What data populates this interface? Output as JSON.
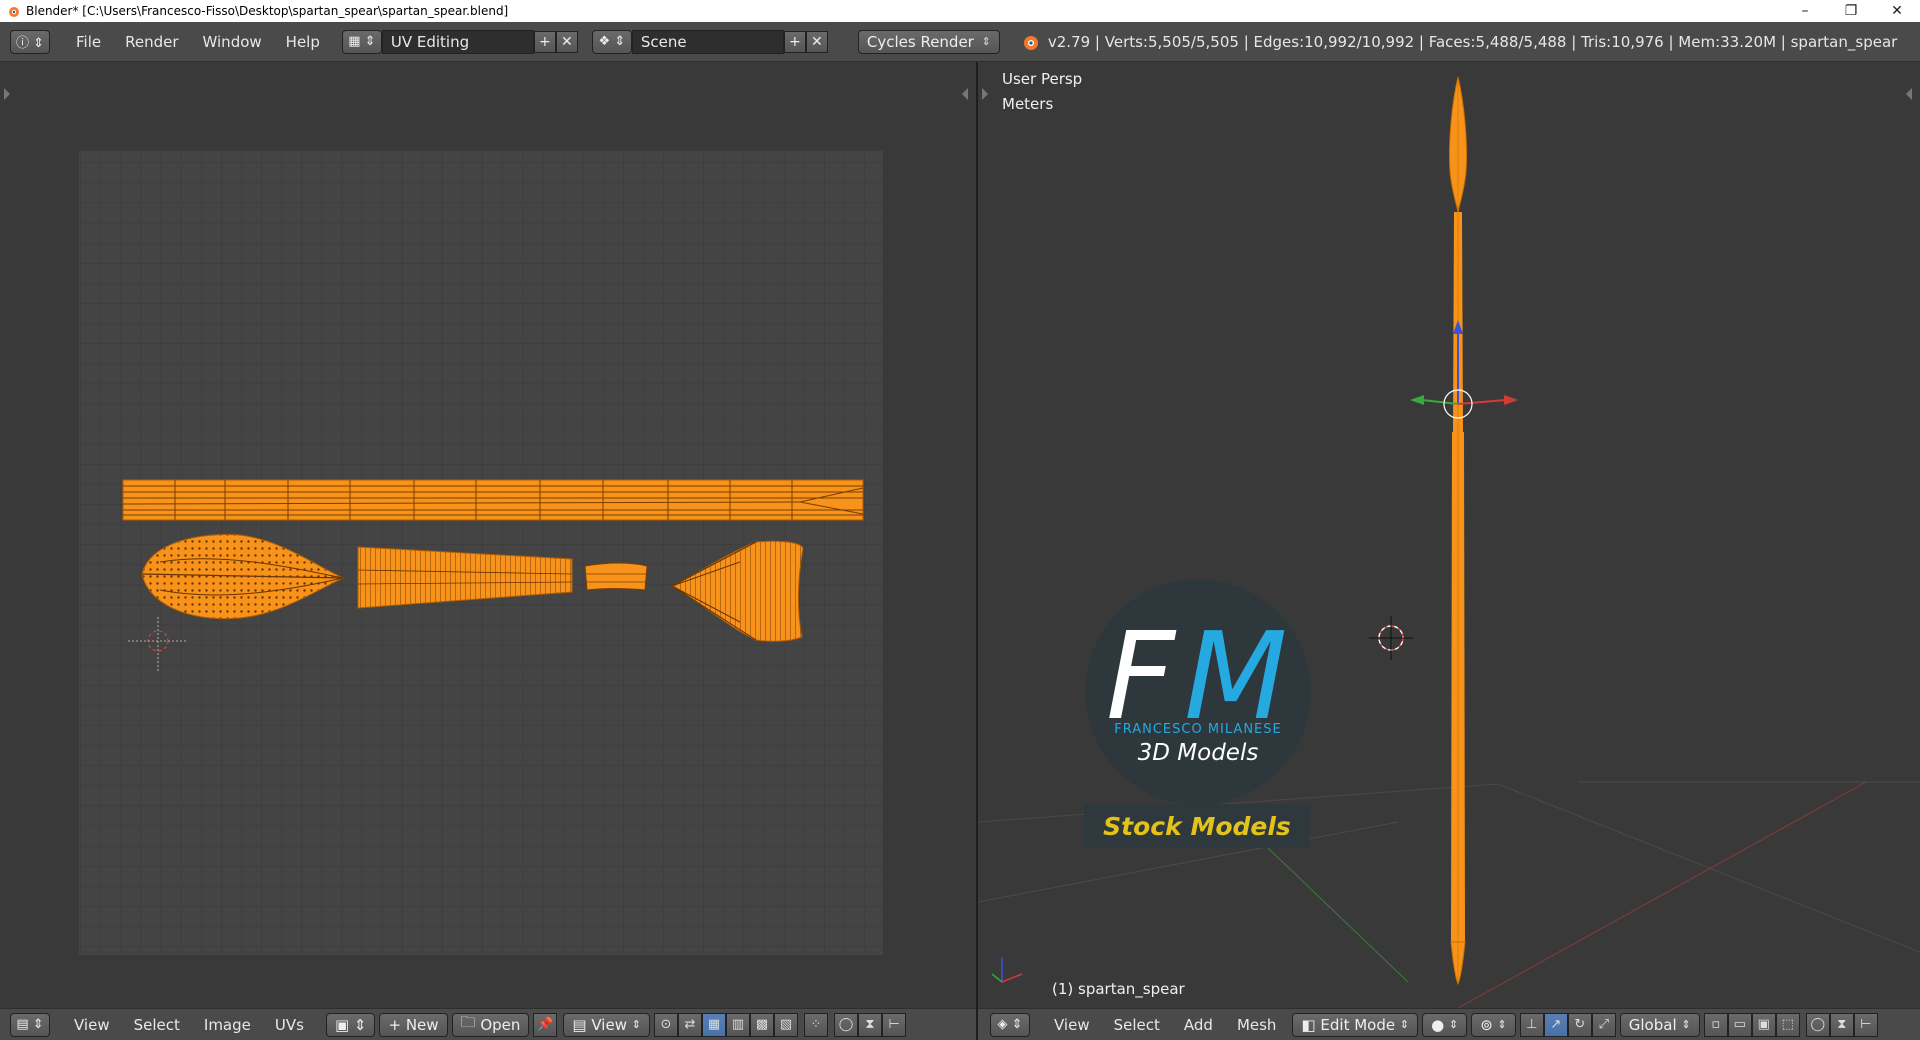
{
  "window": {
    "title": "Blender* [C:\\Users\\Francesco-Fisso\\Desktop\\spartan_spear\\spartan_spear.blend]",
    "minimize_glyph": "–",
    "maximize_glyph": "❐",
    "close_glyph": "✕"
  },
  "header": {
    "menus": [
      "File",
      "Render",
      "Window",
      "Help"
    ],
    "screen_layout": "UV Editing",
    "scene": "Scene",
    "render_engine": "Cycles Render",
    "stats": "v2.79 | Verts:5,505/5,505 | Edges:10,992/10,992 | Faces:5,488/5,488 | Tris:10,976 | Mem:33.20M | spartan_spear"
  },
  "uv_editor": {
    "footer_menus": [
      "View",
      "Select",
      "Image",
      "UVs"
    ],
    "new_label": "New",
    "open_label": "Open",
    "view_label": "View"
  },
  "viewport": {
    "view_name": "User Persp",
    "units": "Meters",
    "object_label": "(1) spartan_spear",
    "footer_menus": [
      "View",
      "Select",
      "Add",
      "Mesh"
    ],
    "mode": "Edit Mode",
    "orientation": "Global"
  },
  "watermark": {
    "logo_letters": "FM",
    "brand": "FRANCESCO MILANESE",
    "subtitle": "3D Models",
    "banner": "Stock Models"
  },
  "colors": {
    "accent_orange": "#f7931a",
    "watermark_blue": "#26a9e0",
    "banner_yellow": "#e3c21a"
  }
}
